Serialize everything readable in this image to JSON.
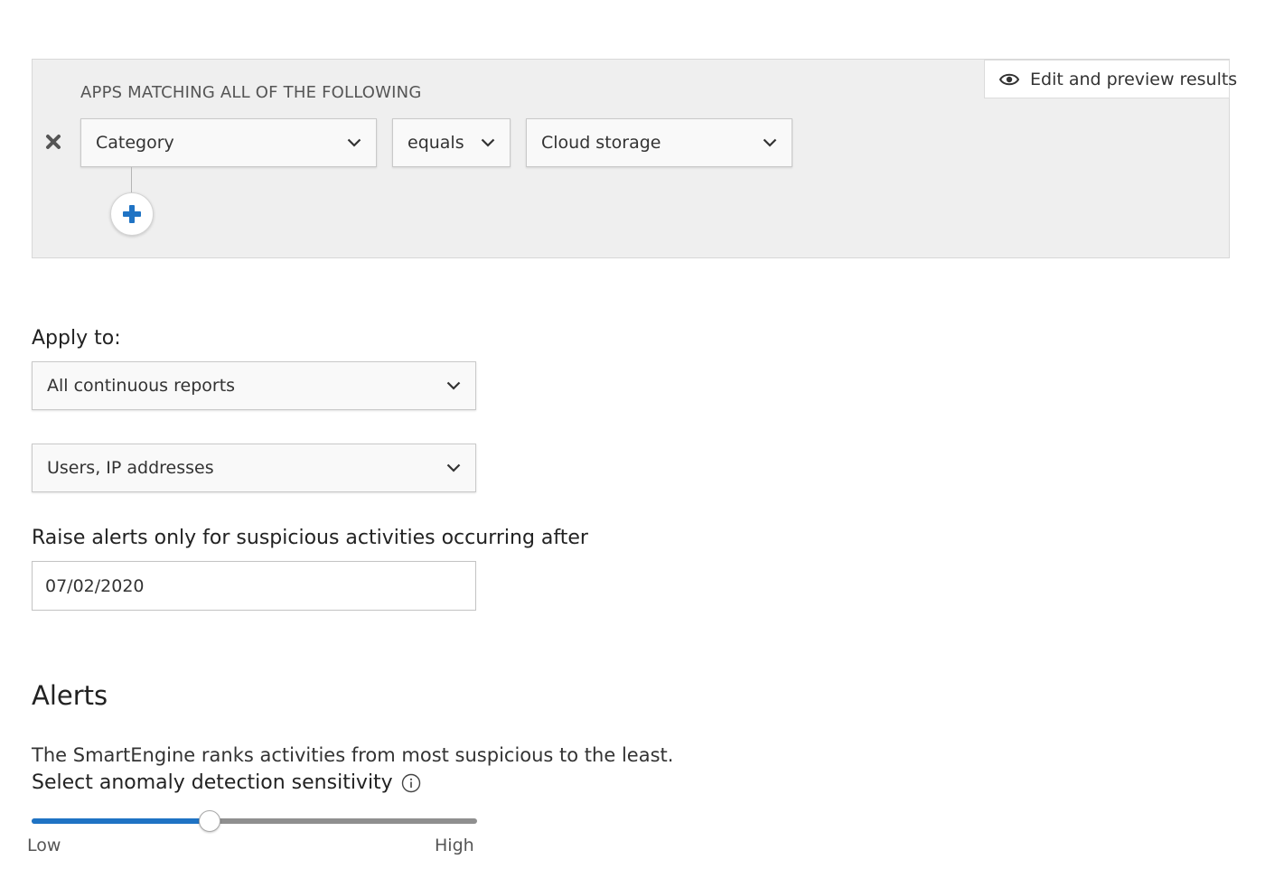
{
  "filter_panel": {
    "heading": "APPS MATCHING ALL OF THE FOLLOWING",
    "preview_button_label": "Edit and preview results",
    "condition": {
      "field": "Category",
      "operator": "equals",
      "value": "Cloud storage"
    },
    "icons": {
      "preview": "eye-icon",
      "remove": "close-icon",
      "add": "plus-icon",
      "dropdown": "chevron-down-icon"
    }
  },
  "apply_to": {
    "label": "Apply to:",
    "reports_select": "All continuous reports",
    "entities_select": "Users, IP addresses"
  },
  "alert_after": {
    "label": "Raise alerts only for suspicious activities occurring after",
    "date_value": "07/02/2020"
  },
  "alerts": {
    "title": "Alerts",
    "description": "The SmartEngine ranks activities from most suspicious to the least.",
    "sensitivity_label": "Select anomaly detection sensitivity",
    "sensitivity_info_icon": "info-icon",
    "slider": {
      "low_label": "Low",
      "high_label": "High",
      "value_fraction": 0.4
    }
  },
  "colors": {
    "accent_blue": "#1f73c4",
    "panel_background": "#efefef"
  }
}
